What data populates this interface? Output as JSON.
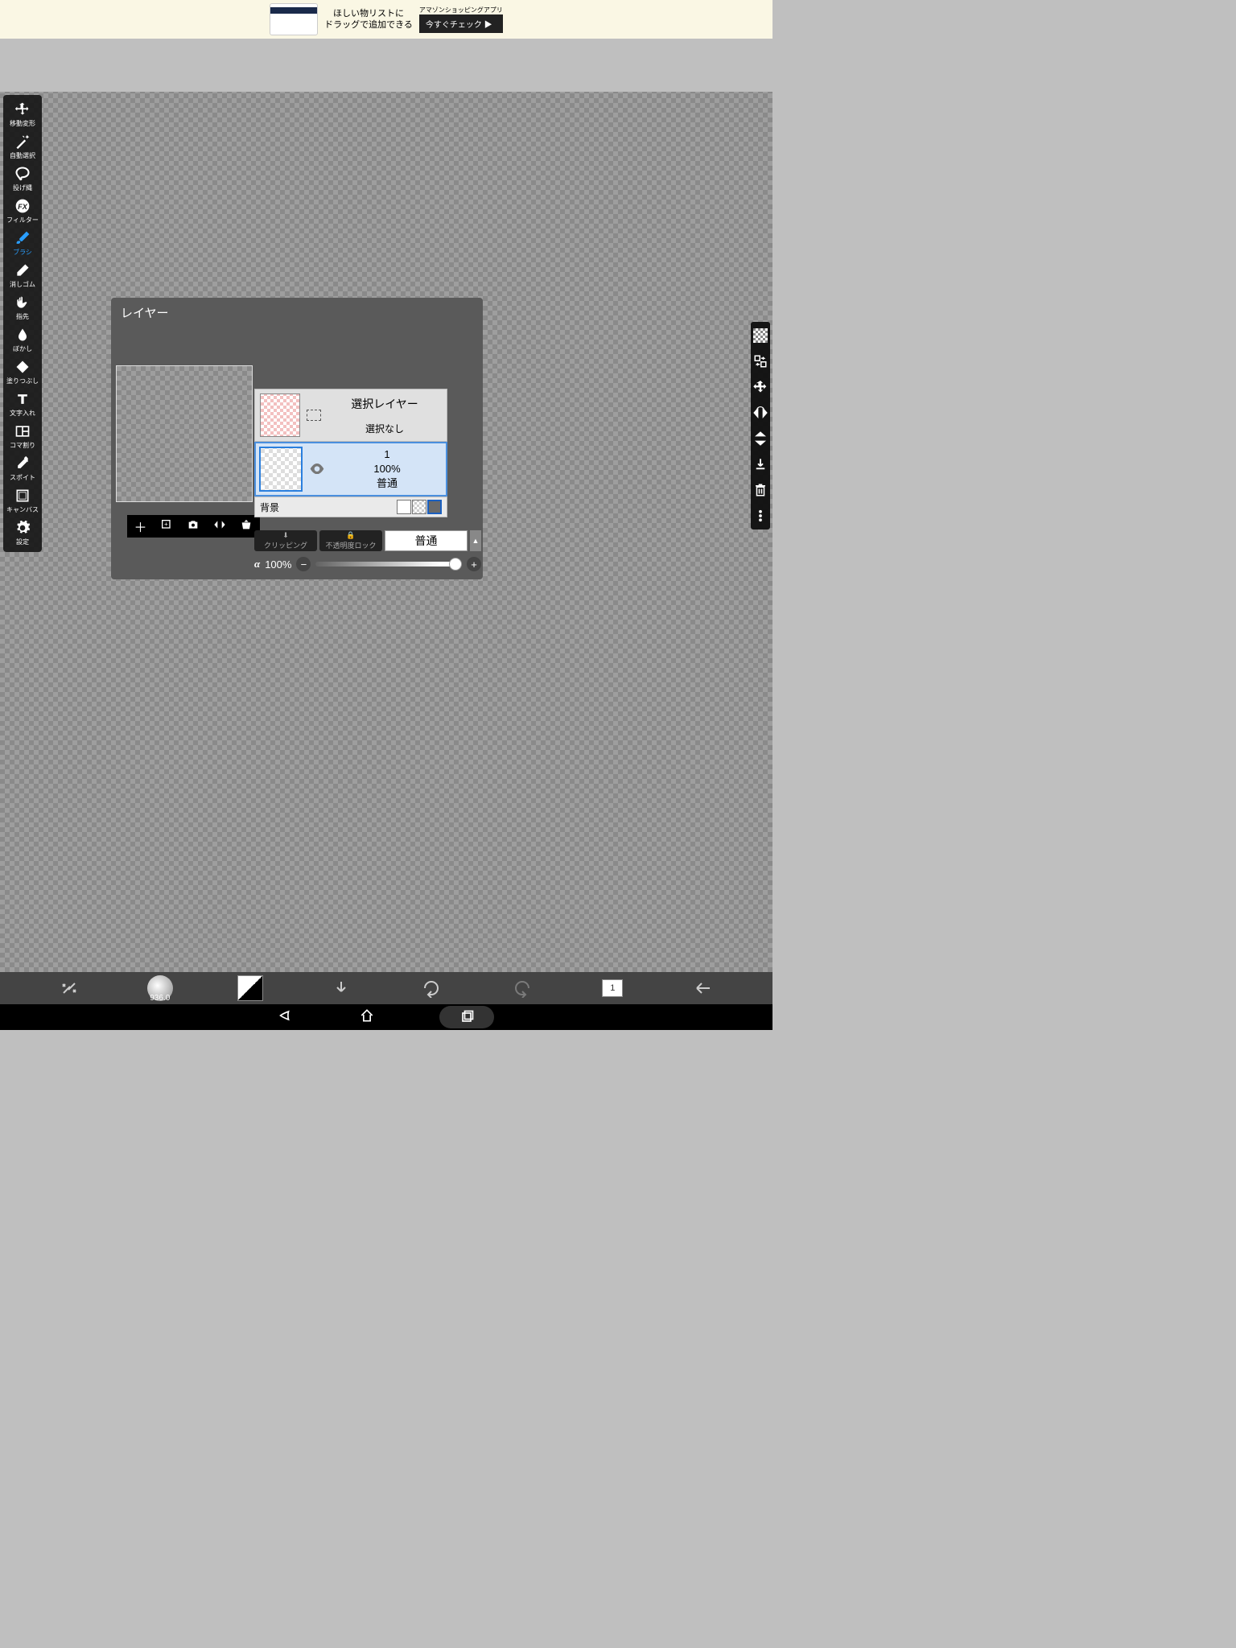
{
  "ad": {
    "line1": "ほしい物リストに",
    "line2": "ドラッグで追加できる",
    "small": "アマゾンショッピングアプリ",
    "button": "今すぐチェック ▶"
  },
  "tools": [
    {
      "id": "move",
      "label": "移動変形"
    },
    {
      "id": "magicwand",
      "label": "自動選択"
    },
    {
      "id": "lasso",
      "label": "投げ縄"
    },
    {
      "id": "filter",
      "label": "フィルター"
    },
    {
      "id": "brush",
      "label": "ブラシ",
      "active": true
    },
    {
      "id": "eraser",
      "label": "消しゴム"
    },
    {
      "id": "finger",
      "label": "指先"
    },
    {
      "id": "blur",
      "label": "ぼかし"
    },
    {
      "id": "fill",
      "label": "塗りつぶし"
    },
    {
      "id": "text",
      "label": "文字入れ"
    },
    {
      "id": "panel",
      "label": "コマ割り"
    },
    {
      "id": "eyedrop",
      "label": "スポイト"
    },
    {
      "id": "canvas",
      "label": "キャンバス"
    },
    {
      "id": "settings",
      "label": "設定"
    }
  ],
  "layerPanel": {
    "title": "レイヤー",
    "selectLayer": {
      "title": "選択レイヤー",
      "status": "選択なし"
    },
    "layer1": {
      "name": "1",
      "opacity": "100%",
      "blend": "普通"
    },
    "background": "背景"
  },
  "clipping": {
    "clip": "クリッピング",
    "alphalock": "不透明度ロック",
    "blendMode": "普通"
  },
  "alpha": {
    "symbol": "α",
    "value": "100%"
  },
  "bottomBar": {
    "brushSize": "936.0",
    "layerCount": "1"
  },
  "fx_label": "FX"
}
